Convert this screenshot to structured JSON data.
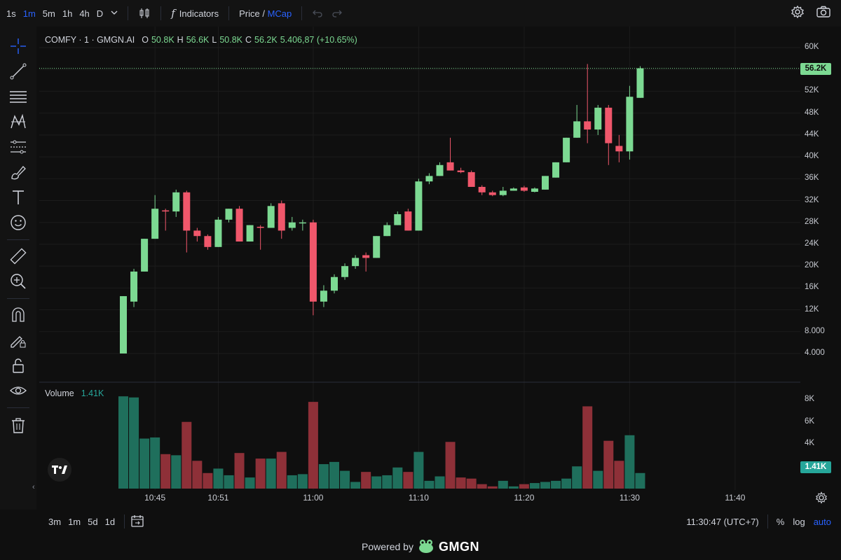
{
  "toolbar": {
    "timeframes": [
      "1s",
      "1m",
      "5m",
      "1h",
      "4h",
      "D"
    ],
    "active_timeframe": "1m",
    "indicators_label": "Indicators",
    "price_label": "Price",
    "price_sep": " / ",
    "mcap_label": "MCap"
  },
  "legend": {
    "symbol": "COMFY · 1 · GMGN.AI",
    "o_key": "O",
    "o_val": "50.8K",
    "h_key": "H",
    "h_val": "56.6K",
    "l_key": "L",
    "l_val": "50.8K",
    "c_key": "C",
    "c_val": "56.2K",
    "change": "5.406,87 (+10.65%)"
  },
  "volume_legend": {
    "label": "Volume",
    "value": "1.41K"
  },
  "price_axis": {
    "labels": [
      "60K",
      "56K",
      "52K",
      "48K",
      "44K",
      "40K",
      "36K",
      "32K",
      "28K",
      "24K",
      "20K",
      "16K",
      "12K",
      "8.000",
      "4.000"
    ],
    "last_price_tag": "56.2K"
  },
  "volume_axis": {
    "labels": [
      "8K",
      "6K",
      "4K",
      "2K"
    ],
    "last_volume_tag": "1.41K"
  },
  "time_axis": {
    "labels": [
      "10:45",
      "10:51",
      "11:00",
      "11:10",
      "11:20",
      "11:30",
      "11:40"
    ]
  },
  "bottombar": {
    "ranges": [
      "3m",
      "1m",
      "5d",
      "1d"
    ],
    "clock": "11:30:47 (UTC+7)",
    "percent": "%",
    "log": "log",
    "auto": "auto"
  },
  "footer": {
    "powered_by": "Powered by",
    "brand": "GMGN"
  },
  "colors": {
    "up": "#7cd992",
    "down": "#f0576b",
    "vol_up": "#1f6f5c",
    "vol_down": "#8e3038",
    "accent": "#2962ff",
    "background": "#0f0f0f"
  },
  "icons": {
    "sidebar": [
      "crosshair-icon",
      "trend-line-icon",
      "horizontal-lines-icon",
      "pattern-icon",
      "prediction-icon",
      "brush-icon",
      "text-icon",
      "emoji-icon",
      "ruler-icon",
      "zoom-in-icon",
      "magnet-icon",
      "lock-drawing-icon",
      "lock-icon",
      "eye-icon",
      "trash-icon"
    ],
    "topbar": [
      "chevron-down-icon",
      "candles-icon",
      "fx-icon",
      "undo-icon",
      "redo-icon",
      "settings-icon",
      "camera-icon"
    ]
  },
  "chart_data": {
    "type": "candlestick",
    "title": "COMFY · 1 · GMGN.AI",
    "xlabel": "",
    "ylabel": "",
    "ylim": [
      0,
      62000
    ],
    "volume_ylim": [
      0,
      8500
    ],
    "grid": true,
    "x": [
      "10:42",
      "10:43",
      "10:44",
      "10:45",
      "10:46",
      "10:47",
      "10:48",
      "10:49",
      "10:50",
      "10:51",
      "10:52",
      "10:53",
      "10:54",
      "10:55",
      "10:56",
      "10:57",
      "10:58",
      "10:59",
      "11:00",
      "11:01",
      "11:02",
      "11:03",
      "11:04",
      "11:05",
      "11:06",
      "11:07",
      "11:08",
      "11:09",
      "11:10",
      "11:11",
      "11:12",
      "11:13",
      "11:14",
      "11:15",
      "11:16",
      "11:17",
      "11:18",
      "11:19",
      "11:20",
      "11:21",
      "11:22",
      "11:23",
      "11:24",
      "11:25",
      "11:26",
      "11:27",
      "11:28",
      "11:29",
      "11:30"
    ],
    "candles": [
      {
        "o": 4000,
        "h": 14500,
        "l": 4000,
        "c": 14500
      },
      {
        "o": 13500,
        "h": 19500,
        "l": 12500,
        "c": 19000
      },
      {
        "o": 19000,
        "h": 25000,
        "l": 19000,
        "c": 25000
      },
      {
        "o": 25000,
        "h": 33000,
        "l": 25000,
        "c": 30500
      },
      {
        "o": 30200,
        "h": 30500,
        "l": 26500,
        "c": 30000
      },
      {
        "o": 30000,
        "h": 34000,
        "l": 29000,
        "c": 33500
      },
      {
        "o": 33500,
        "h": 33800,
        "l": 22500,
        "c": 26500
      },
      {
        "o": 26500,
        "h": 27000,
        "l": 24500,
        "c": 25500
      },
      {
        "o": 25500,
        "h": 25800,
        "l": 23000,
        "c": 23500
      },
      {
        "o": 23500,
        "h": 29000,
        "l": 23500,
        "c": 28500
      },
      {
        "o": 28500,
        "h": 30500,
        "l": 28000,
        "c": 30500
      },
      {
        "o": 30500,
        "h": 31000,
        "l": 24500,
        "c": 24500
      },
      {
        "o": 24500,
        "h": 27500,
        "l": 24500,
        "c": 27500
      },
      {
        "o": 27200,
        "h": 27500,
        "l": 23000,
        "c": 27000
      },
      {
        "o": 27000,
        "h": 31500,
        "l": 27000,
        "c": 31000
      },
      {
        "o": 31500,
        "h": 32000,
        "l": 25000,
        "c": 26500
      },
      {
        "o": 27000,
        "h": 29000,
        "l": 26500,
        "c": 28000
      },
      {
        "o": 28000,
        "h": 28500,
        "l": 26500,
        "c": 28000
      },
      {
        "o": 28000,
        "h": 28500,
        "l": 11000,
        "c": 13500
      },
      {
        "o": 13500,
        "h": 16500,
        "l": 12500,
        "c": 15500
      },
      {
        "o": 15500,
        "h": 18500,
        "l": 15000,
        "c": 18000
      },
      {
        "o": 18000,
        "h": 20500,
        "l": 17500,
        "c": 20000
      },
      {
        "o": 20000,
        "h": 22000,
        "l": 19500,
        "c": 21500
      },
      {
        "o": 22000,
        "h": 22500,
        "l": 19000,
        "c": 21500
      },
      {
        "o": 21500,
        "h": 25500,
        "l": 21500,
        "c": 25500
      },
      {
        "o": 25500,
        "h": 28000,
        "l": 25500,
        "c": 27500
      },
      {
        "o": 27500,
        "h": 30000,
        "l": 27500,
        "c": 29500
      },
      {
        "o": 30000,
        "h": 30500,
        "l": 26500,
        "c": 26500
      },
      {
        "o": 26500,
        "h": 36000,
        "l": 26500,
        "c": 35500
      },
      {
        "o": 35500,
        "h": 37000,
        "l": 35000,
        "c": 36500
      },
      {
        "o": 36500,
        "h": 39000,
        "l": 36500,
        "c": 38500
      },
      {
        "o": 39000,
        "h": 43500,
        "l": 37500,
        "c": 37500
      },
      {
        "o": 37500,
        "h": 38000,
        "l": 37000,
        "c": 37200
      },
      {
        "o": 37200,
        "h": 37500,
        "l": 34500,
        "c": 34500
      },
      {
        "o": 34500,
        "h": 34800,
        "l": 33000,
        "c": 33500
      },
      {
        "o": 33500,
        "h": 33800,
        "l": 32800,
        "c": 33000
      },
      {
        "o": 33000,
        "h": 34500,
        "l": 32800,
        "c": 33800
      },
      {
        "o": 33800,
        "h": 34400,
        "l": 33800,
        "c": 34200
      },
      {
        "o": 34400,
        "h": 34700,
        "l": 33600,
        "c": 33800
      },
      {
        "o": 33600,
        "h": 34400,
        "l": 33500,
        "c": 34200
      },
      {
        "o": 34000,
        "h": 36500,
        "l": 34000,
        "c": 36500
      },
      {
        "o": 36200,
        "h": 39000,
        "l": 36200,
        "c": 39000
      },
      {
        "o": 39000,
        "h": 43500,
        "l": 39000,
        "c": 43500
      },
      {
        "o": 43500,
        "h": 49500,
        "l": 43500,
        "c": 46500
      },
      {
        "o": 46500,
        "h": 57000,
        "l": 42500,
        "c": 45000
      },
      {
        "o": 45000,
        "h": 49500,
        "l": 44000,
        "c": 49000
      },
      {
        "o": 49000,
        "h": 49500,
        "l": 38500,
        "c": 42500
      },
      {
        "o": 42000,
        "h": 44000,
        "l": 39000,
        "c": 41000
      },
      {
        "o": 41000,
        "h": 53000,
        "l": 39500,
        "c": 51000
      },
      {
        "o": 50800,
        "h": 56600,
        "l": 50800,
        "c": 56200
      }
    ],
    "volume": [
      8300,
      8200,
      4500,
      4600,
      3100,
      3000,
      6000,
      2500,
      1400,
      1800,
      1200,
      3200,
      1000,
      2700,
      2700,
      3300,
      1200,
      1300,
      7800,
      2200,
      2400,
      1600,
      600,
      1500,
      1100,
      1200,
      1900,
      1500,
      3300,
      700,
      1100,
      4200,
      1000,
      900,
      400,
      200,
      700,
      200,
      400,
      500,
      600,
      700,
      900,
      2000,
      7400,
      1600,
      4300,
      2500,
      4800,
      1400
    ],
    "series_directions": "derived from candles (close >= open = up)"
  }
}
